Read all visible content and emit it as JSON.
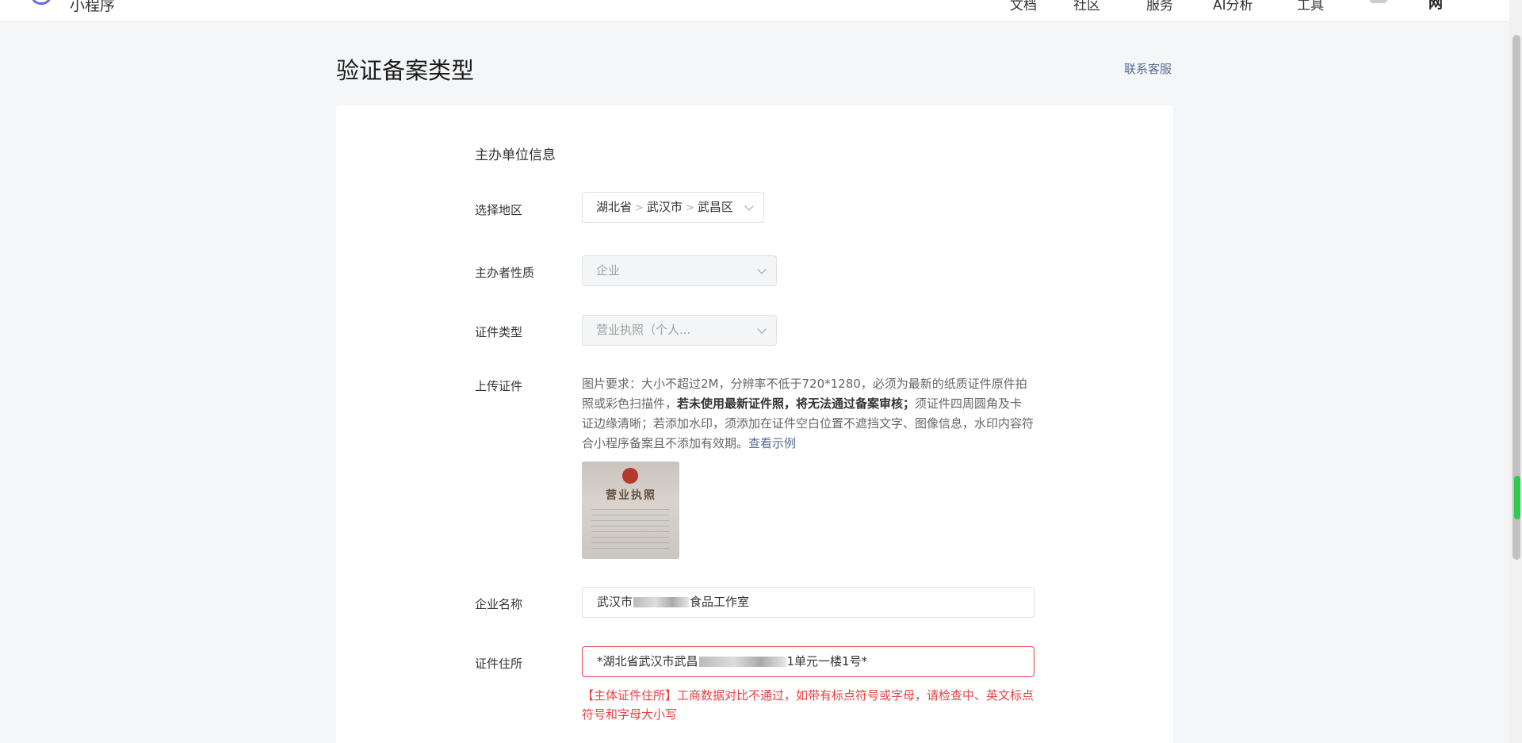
{
  "topnav": {
    "brand": "小程序",
    "items": [
      "文档",
      "社区",
      "服务",
      "AI分析",
      "工具"
    ],
    "user": "网"
  },
  "page": {
    "title": "验证备案类型",
    "contact_link": "联系客服"
  },
  "section": {
    "title": "主办单位信息"
  },
  "region": {
    "label": "选择地区",
    "province": "湖北省",
    "city": "武汉市",
    "district": "武昌区"
  },
  "sponsor_type": {
    "label": "主办者性质",
    "value": "企业"
  },
  "cert_type": {
    "label": "证件类型",
    "value": "营业执照（个人..."
  },
  "upload": {
    "label": "上传证件",
    "desc_part1": "图片要求：大小不超过2M，分辨率不低于720*1280，必须为最新的纸质证件原件拍照或彩色扫描件，",
    "desc_bold": "若未使用最新证件照，将无法通过备案审核；",
    "desc_part2": "须证件四周圆角及卡证边缘清晰；若添加水印，须添加在证件空白位置不遮挡文字、图像信息，水印内容符合小程序备案且不添加有效期。",
    "example_link": "查看示例",
    "thumb_title": "营业执照"
  },
  "company_name": {
    "label": "企业名称",
    "prefix": "武汉市",
    "suffix": "食品工作室"
  },
  "cert_address": {
    "label": "证件住所",
    "prefix": "*湖北省武汉市武昌",
    "suffix": "1单元一楼1号*",
    "error": "【主体证件住所】工商数据对比不通过，如带有标点符号或字母，请检查中、英文标点符号和字母大小写"
  },
  "colors": {
    "link": "#576b95",
    "error": "#e64340",
    "page_bg": "#f5f6f7",
    "brand_icon": "#6467f0"
  }
}
